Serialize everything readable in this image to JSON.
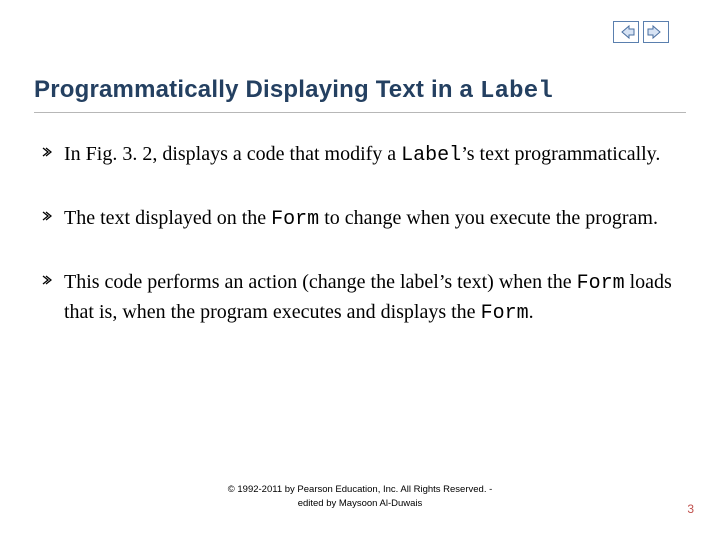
{
  "nav": {
    "prev_icon_name": "arrow-left-icon",
    "next_icon_name": "arrow-right-icon"
  },
  "title": {
    "prefix": "Programmatically Displaying Text in a ",
    "code_word": "Label"
  },
  "bullets": [
    {
      "parts": [
        {
          "t": "In Fig. 3. 2, displays a code that modify a ",
          "code": false
        },
        {
          "t": "Label",
          "code": true
        },
        {
          "t": "’s text programmatically.",
          "code": false
        }
      ]
    },
    {
      "parts": [
        {
          "t": "The text displayed on the ",
          "code": false
        },
        {
          "t": "Form",
          "code": true
        },
        {
          "t": " to change when you execute the program.",
          "code": false
        }
      ]
    },
    {
      "parts": [
        {
          "t": "This code performs an action (change the label’s text) when the ",
          "code": false
        },
        {
          "t": "Form",
          "code": true
        },
        {
          "t": " loads that is, when the program executes and displays the ",
          "code": false
        },
        {
          "t": "Form",
          "code": true
        },
        {
          "t": ".",
          "code": false
        }
      ]
    }
  ],
  "footer": {
    "line1": "© 1992-2011 by Pearson Education, Inc. All Rights Reserved. -",
    "line2": "edited by Maysoon Al-Duwais"
  },
  "page_number": "3",
  "bullet_glyph": "։"
}
